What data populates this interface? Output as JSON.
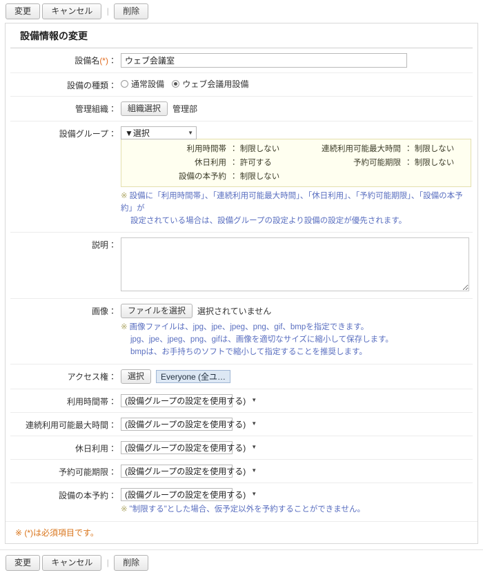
{
  "toolbar": {
    "submit_label": "変更",
    "cancel_label": "キャンセル",
    "separator": "|",
    "delete_label": "削除"
  },
  "page": {
    "title": "設備情報の変更"
  },
  "form": {
    "facility_name": {
      "label": "設備名",
      "required_mark": "(*)",
      "colon": "：",
      "value": "ウェブ会議室"
    },
    "facility_type": {
      "label": "設備の種類",
      "colon": "：",
      "options": [
        {
          "label": "通常設備",
          "selected": false
        },
        {
          "label": "ウェブ会議用設備",
          "selected": true
        }
      ]
    },
    "管理組織": {
      "label": "管理組織",
      "colon": "：",
      "button_label": "組織選択",
      "value": "管理部"
    },
    "facility_group": {
      "label": "設備グループ",
      "colon": "：",
      "select_value": "▼選択",
      "caret": "▼",
      "info": [
        {
          "key": "利用時間帯",
          "colon": "：",
          "value": "制限しない"
        },
        {
          "key": "連続利用可能最大時間",
          "colon": "：",
          "value": "制限しない"
        },
        {
          "key": "休日利用",
          "colon": "：",
          "value": "許可する"
        },
        {
          "key": "予約可能期限",
          "colon": "：",
          "value": "制限しない"
        },
        {
          "key": "設備の本予約",
          "colon": "：",
          "value": "制限しない"
        }
      ],
      "note_line1": "設備に「利用時間帯」、「連続利用可能最大時間」、「休日利用」、「予約可能期限」、「設備の本予約」が",
      "note_line2": "設定されている場合は、設備グループの設定より設備の設定が優先されます。",
      "note_mark": "※"
    },
    "description": {
      "label": "説明",
      "colon": "：",
      "value": ""
    },
    "image": {
      "label": "画像",
      "colon": "：",
      "button_label": "ファイルを選択",
      "status_text": "選択されていません",
      "note_mark": "※",
      "note_line1": "画像ファイルは、jpg、jpe、jpeg、png、gif、bmpを指定できます。",
      "note_line2": "jpg、jpe、jpeg、png、gifは、画像を適切なサイズに縮小して保存します。",
      "note_line3": "bmpは、お手持ちのソフトで縮小して指定することを推奨します。"
    },
    "access_rights": {
      "label": "アクセス権",
      "colon": "：",
      "button_label": "選択",
      "value": "Everyone (全ユ…"
    },
    "settings": [
      {
        "label": "利用時間帯",
        "colon": "：",
        "value": "(設備グループの設定を使用する)"
      },
      {
        "label": "連続利用可能最大時間",
        "colon": "：",
        "value": "(設備グループの設定を使用する)"
      },
      {
        "label": "休日利用",
        "colon": "：",
        "value": "(設備グループの設定を使用する)"
      },
      {
        "label": "予約可能期限",
        "colon": "：",
        "value": "(設備グループの設定を使用する)"
      },
      {
        "label": "設備の本予約",
        "colon": "：",
        "value": "(設備グループの設定を使用する)",
        "note_mark": "※",
        "note": "\"制限する\"とした場合、仮予定以外を予約することができません。"
      }
    ],
    "footnote": "※ (*)は必須項目です。"
  }
}
